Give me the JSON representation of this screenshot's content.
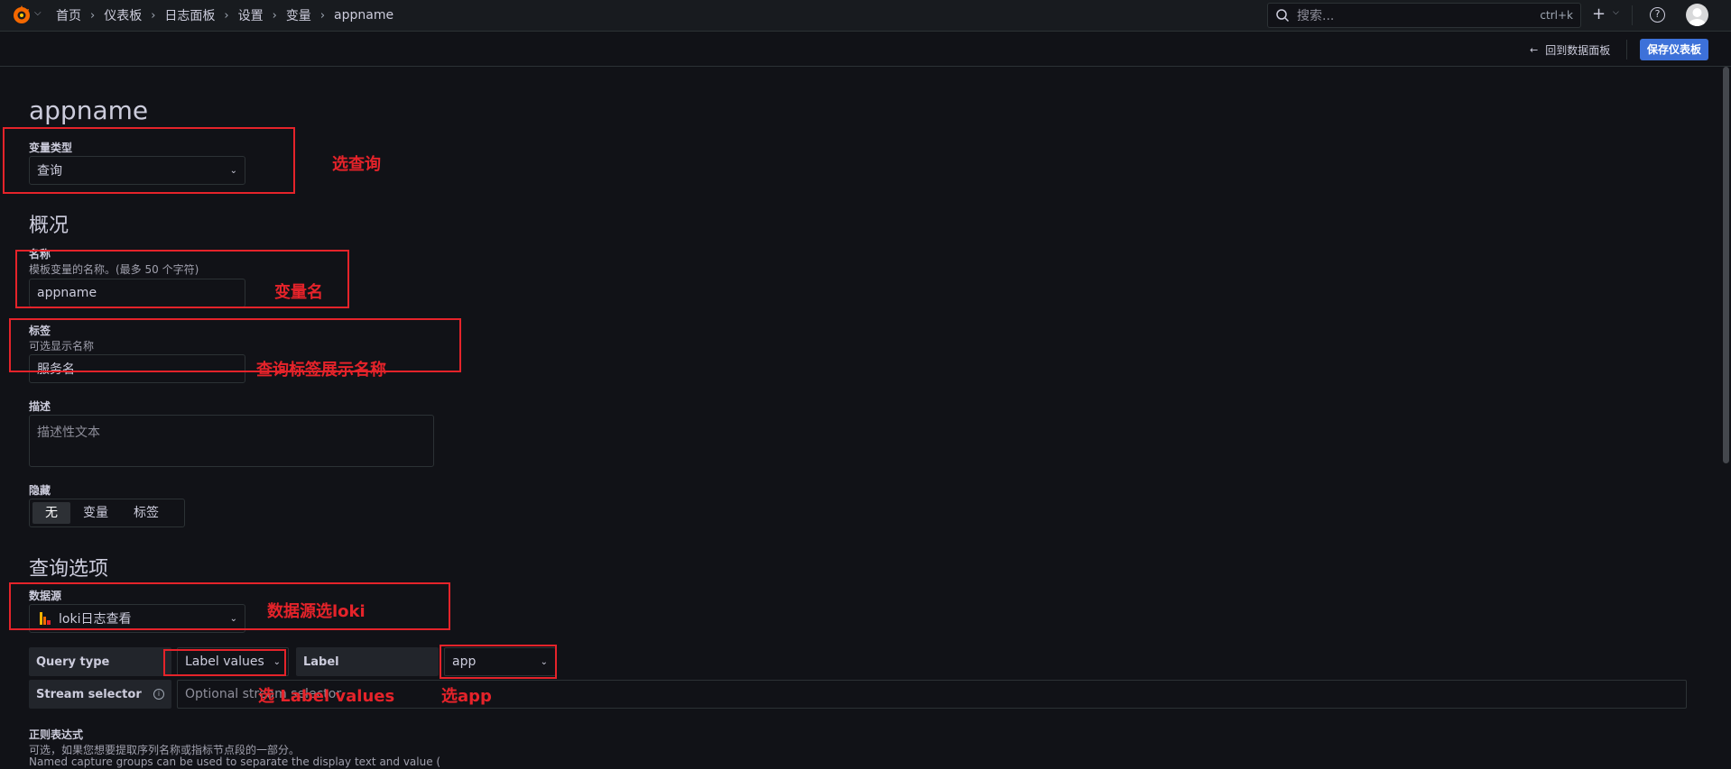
{
  "topbar": {
    "breadcrumb": [
      "首页",
      "仪表板",
      "日志面板",
      "设置",
      "变量",
      "appname"
    ],
    "search_placeholder": "搜索...",
    "search_shortcut": "ctrl+k",
    "plus_icon": "+",
    "help_icon": "?"
  },
  "subbar": {
    "back_label": "回到数据面板",
    "save_label": "保存仪表板"
  },
  "page": {
    "title": "appname",
    "variable_type_label": "变量类型",
    "variable_type_value": "查询",
    "overview_title": "概况",
    "name_label": "名称",
    "name_desc": "模板变量的名称。(最多 50 个字符)",
    "name_value": "appname",
    "label_label": "标签",
    "label_desc": "可选显示名称",
    "label_value": "服务名",
    "desc_label": "描述",
    "desc_placeholder": "描述性文本",
    "hide_label": "隐藏",
    "hide_options": [
      "无",
      "变量",
      "标签"
    ],
    "hide_selected": "无",
    "query_options_title": "查询选项",
    "datasource_label": "数据源",
    "datasource_value": "loki日志查看",
    "query_type_label": "Query type",
    "query_type_value": "Label values",
    "label_field_label": "Label",
    "label_field_value": "app",
    "stream_selector_label": "Stream selector",
    "stream_selector_placeholder": "Optional stream selector",
    "regex_label": "正则表达式",
    "regex_desc": "可选，如果您想要提取序列名称或指标节点段的一部分。",
    "regex_desc2": "Named capture groups can be used to separate the display text and value ("
  },
  "annotations": {
    "note1": "选查询",
    "note2": "变量名",
    "note3": "查询标签展示名称",
    "note4": "数据源选loki",
    "note5": "选 Label values",
    "note6": "选app"
  },
  "colors": {
    "background": "#111217",
    "accent": "#3d71d9",
    "annotation": "#e5232a"
  }
}
